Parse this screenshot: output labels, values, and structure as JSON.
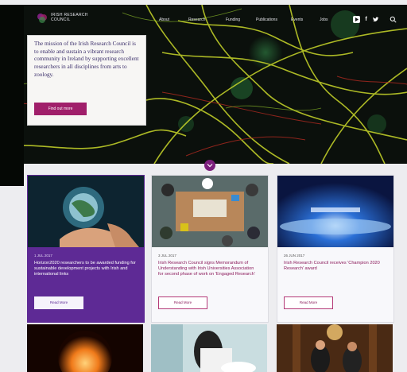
{
  "nav": {
    "logo_text": "IRISH RESEARCH COUNCIL",
    "menu": [
      "About",
      "Research",
      "Funding",
      "Publications",
      "Events",
      "Jobs"
    ],
    "social_icons": [
      "youtube-icon",
      "facebook-icon",
      "twitter-icon",
      "search-icon"
    ]
  },
  "hero": {
    "mission_text": "The mission of the Irish Research Council is to enable and sustain a vibrant research community in Ireland by supporting excellent researchers in all disciplines from arts to zoology.",
    "button_label": "Find out more"
  },
  "cards": [
    {
      "date": "1 JUL 2017",
      "text": "Horizon2020 researchers to be awarded funding for sustainable development projects with Irish and international links",
      "button": "Read More"
    },
    {
      "date": "3 JUL 2017",
      "text": "Irish Research Council signs Memorandum of Understanding with Irish Universities Association for second phase of work on 'Engaged Research'",
      "button": "Read More"
    },
    {
      "date": "26 JUN 2017",
      "text": "Irish Research Council receives 'Champion 2020 Research' award",
      "button": "Read More"
    }
  ],
  "colors": {
    "brand_purple": "#5e2a95",
    "brand_magenta": "#a01f6a",
    "mission_text": "#3b2f6b"
  }
}
